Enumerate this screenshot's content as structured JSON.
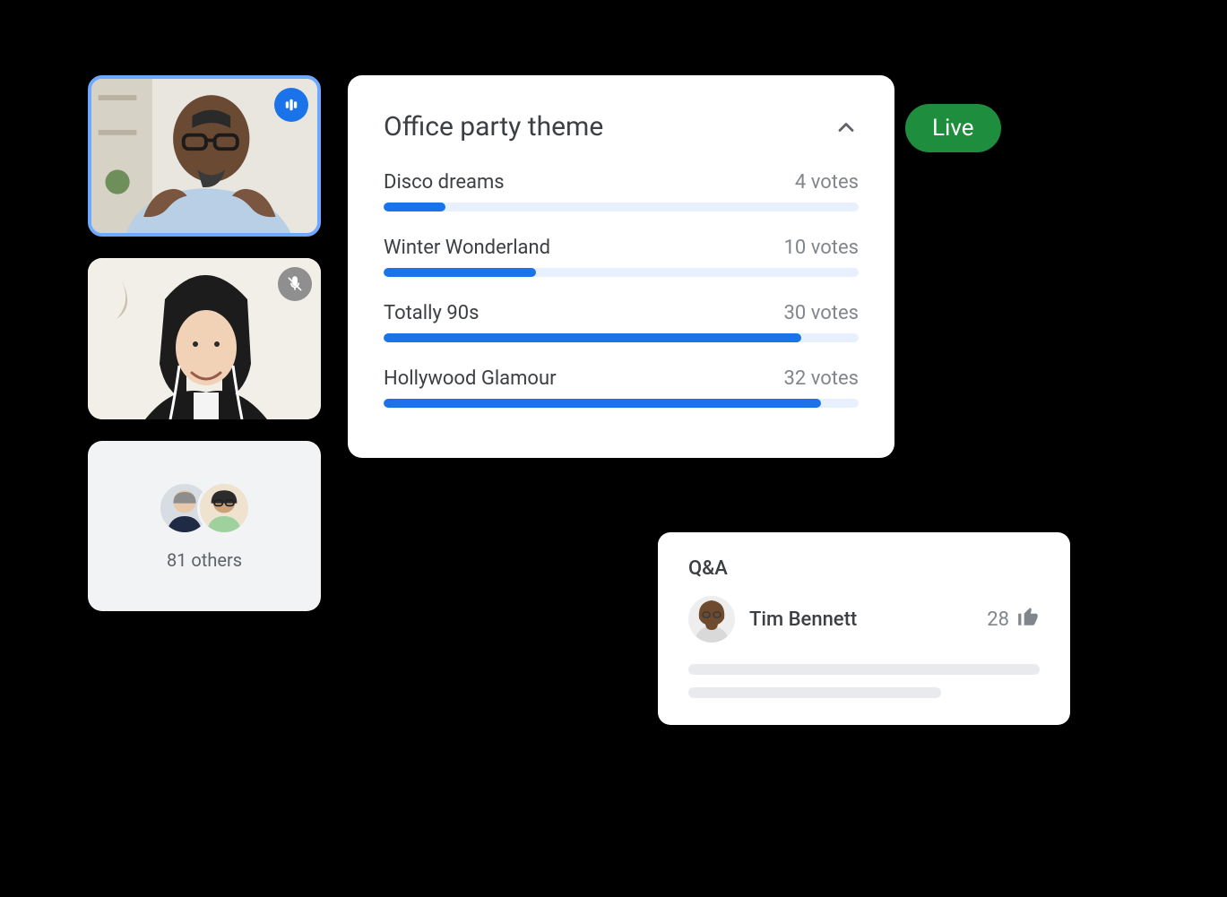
{
  "live_label": "Live",
  "participants": {
    "others_count_label": "81 others"
  },
  "poll": {
    "title": "Office party theme",
    "options": [
      {
        "label": "Disco dreams",
        "votes_label": "4 votes",
        "pct": 13
      },
      {
        "label": "Winter Wonderland",
        "votes_label": "10 votes",
        "pct": 32
      },
      {
        "label": "Totally 90s",
        "votes_label": "30 votes",
        "pct": 88
      },
      {
        "label": "Hollywood Glamour",
        "votes_label": "32 votes",
        "pct": 92
      }
    ]
  },
  "qa": {
    "title": "Q&A",
    "author": "Tim Bennett",
    "upvotes": "28"
  },
  "icons": {
    "speaking": "speaking-indicator-icon",
    "muted": "mic-off-icon",
    "chevron": "chevron-up-icon",
    "thumb": "thumb-up-icon"
  },
  "chart_data": {
    "type": "bar",
    "title": "Office party theme",
    "xlabel": "",
    "ylabel": "votes",
    "ylim": [
      0,
      35
    ],
    "categories": [
      "Disco dreams",
      "Winter Wonderland",
      "Totally 90s",
      "Hollywood Glamour"
    ],
    "values": [
      4,
      10,
      30,
      32
    ]
  }
}
